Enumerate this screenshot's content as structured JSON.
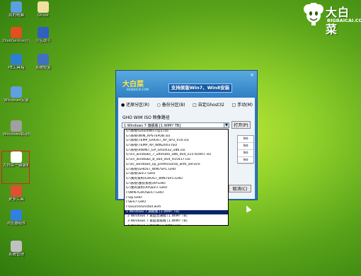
{
  "desktop_icons": [
    {
      "label": "我的电脑",
      "name": "my-computer-icon",
      "color": "#5aa0e0"
    },
    {
      "label": "Ghost",
      "name": "ghost-icon",
      "color": "#f0e0a0"
    },
    {
      "label": "DiskGenius分区工具",
      "name": "diskgenius-icon",
      "color": "#e05020"
    },
    {
      "label": "分区助手",
      "name": "partition-assistant-icon",
      "color": "#3060c0"
    },
    {
      "label": "PE工具箱",
      "name": "pe-toolbox-icon",
      "color": "#2f7fd0"
    },
    {
      "label": "系统修复",
      "name": "system-repair-icon",
      "color": "#4070c0"
    },
    {
      "label": "Windows安装",
      "name": "windows-install-icon",
      "color": "#60a0e0"
    },
    {
      "label": "Windows启动修复",
      "name": "windows-boot-repair-icon",
      "color": "#a0a0a0"
    },
    {
      "label": "大白菜一键装机",
      "name": "bigbaicai-install-icon",
      "color": "#ffffff"
    },
    {
      "label": "更多工具",
      "name": "more-tools-icon",
      "color": "#e05030"
    },
    {
      "label": "浏览器组件",
      "name": "browser-icon",
      "color": "#3080e0"
    },
    {
      "label": "系统管理",
      "name": "system-manage-icon",
      "color": "#c0c0c0"
    }
  ],
  "logo": {
    "cn": "大白菜",
    "en": "BIGBAICAI.COM"
  },
  "dialog": {
    "close": "×",
    "logo_cn": "大白菜",
    "logo_en": "BIGBAICAI.COM",
    "slogan": "支持原版Win7、Win8安装",
    "radio_restore": "● 还原分区(R)",
    "radio_backup": "○ 备份分区(B)",
    "radio_custom": "□ 自定Ghost32",
    "radio_manual": "□ 手动(M)",
    "iso_label": "GHO WIM ISO 映像路径",
    "combo_value": "1 Windows 7 旗舰版 [1.WIM? TB]",
    "open_button": "打开(P)",
    "cancel_button": "取消(C)",
    "side_grid": [
      "iso",
      "iso",
      "iso",
      "iso"
    ]
  },
  "dropdown_items": [
    {
      "text": "G:\\系统\\GhostWin7sp1.iso",
      "hl": false
    },
    {
      "text": "G:\\系统\\WIN_XPSTEPDB.iso",
      "hl": false
    },
    {
      "text": "G:\\系统\\TEMP_GHOST_XP_SP3_V10.iso",
      "hl": false
    },
    {
      "text": "G:\\系统\\TEMP_XP_WIN2003.ISO",
      "hl": false
    },
    {
      "text": "G:\\系统\\XWIN7_GP_Ghost32_x86.iso",
      "hl": false
    },
    {
      "text": "G:\\cn_windows_7_ultimate_x86_dvd_x15-65907.iso",
      "hl": false
    },
    {
      "text": "G:\\cn_windows_8_x64_dvd_915417.iso",
      "hl": false
    },
    {
      "text": "G:\\sc_windows_xp_professional_with_service",
      "hl": false
    },
    {
      "text": "G:\\系统\\GHOST_WIN7SP1.GHO",
      "hl": false
    },
    {
      "text": "G:\\系统\\win7.GHO",
      "hl": false
    },
    {
      "text": "G:\\我的资料\\GHOST_WIN7SP1.GHO",
      "hl": false
    },
    {
      "text": "G:\\系统\\重装系统\\XP.GHO",
      "hl": false
    },
    {
      "text": "G:\\我的资料\\XP\\win7.GHO",
      "hl": false
    },
    {
      "text": "I:\\WIN7GHO\\win7.GHO",
      "hl": false
    },
    {
      "text": "I:\\xp.GHO",
      "hl": false
    },
    {
      "text": "I:\\win7.GHO",
      "hl": false
    },
    {
      "text": "I:\\sources\\install.wim",
      "hl": false
    },
    {
      "text": "1 Windows 7 旗舰版 [1.WIM? TB]",
      "hl": true
    },
    {
      "text": "2 Windows 7 家庭普通版 [1.WIM? TB]",
      "hl": false
    },
    {
      "text": "3 Windows 7 家庭高级版 [1.WIM? TB]",
      "hl": false
    },
    {
      "text": "4 Windows 7 专业版 [1.WIM? TB]",
      "hl": false
    },
    {
      "text": "5 Windows 7 旗舰版 [1.WIM? TB]",
      "hl": false
    }
  ]
}
